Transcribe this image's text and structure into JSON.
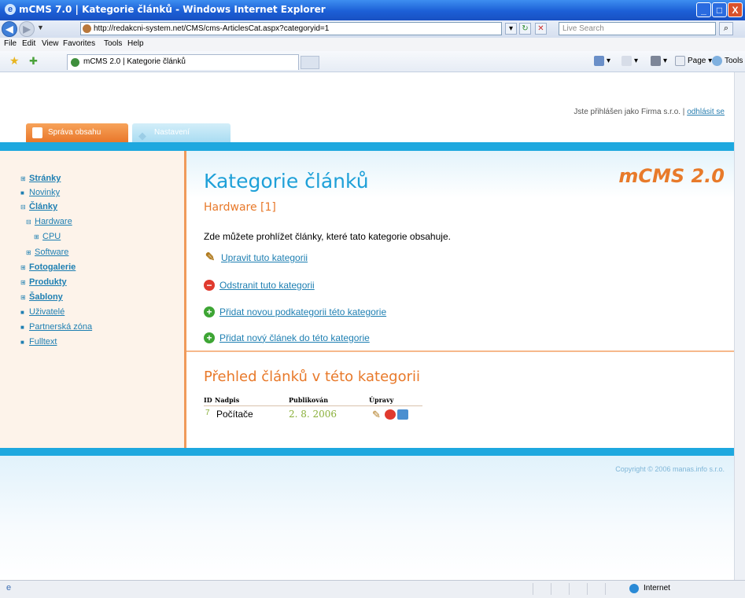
{
  "window": {
    "title": "mCMS 7.0 | Kategorie článků - Windows Internet Explorer",
    "min": "_",
    "max": "□",
    "close": "X"
  },
  "browser": {
    "url": "http://redakcni-system.net/CMS/cms-ArticlesCat.aspx?categoryid=1",
    "search_placeholder": "Live Search",
    "menu": [
      "File",
      "Edit",
      "View",
      "Favorites",
      "Tools",
      "Help"
    ],
    "tab_title": "mCMS 2.0 | Kategorie článků",
    "commands": {
      "page": "Page",
      "tools": "Tools"
    }
  },
  "header": {
    "logged_in": "Jste přihlášen jako Firma s.r.o. |",
    "logout": "odhlásit se",
    "tab_content": "Správa obsahu",
    "tab_settings": "Nastavení"
  },
  "sidebar": {
    "items": [
      {
        "label": "Stránky",
        "marker": "⊞",
        "bold": true
      },
      {
        "label": "Novinky",
        "marker": "■",
        "bold": false
      },
      {
        "label": "Články",
        "marker": "⊟",
        "bold": true
      },
      {
        "label": "Hardware",
        "marker": "⊟",
        "bold": false
      },
      {
        "label": "CPU",
        "marker": "⊞",
        "bold": false
      },
      {
        "label": "Software",
        "marker": "⊞",
        "bold": false
      },
      {
        "label": "Fotogalerie",
        "marker": "⊞",
        "bold": true
      },
      {
        "label": "Produkty",
        "marker": "⊞",
        "bold": true
      },
      {
        "label": "Šablony",
        "marker": "⊞",
        "bold": true
      },
      {
        "label": "Uživatelé",
        "marker": "■",
        "bold": false
      },
      {
        "label": "Partnerská zóna",
        "marker": "■",
        "bold": false
      },
      {
        "label": "Fulltext",
        "marker": "■",
        "bold": false
      }
    ]
  },
  "main": {
    "logo": "mCMS 2.0",
    "title": "Kategorie článků",
    "subtitle": "Hardware [1]",
    "intro": "Zde můžete prohlížet články, které tato kategorie obsahuje.",
    "actions": [
      "Upravit tuto kategorii",
      "Odstranit tuto kategorii",
      "Přidat novou podkategorii této kategorie",
      "Přidat nový článek do této kategorie"
    ],
    "section_title": "Přehled článků v této kategorii",
    "table": {
      "headers": [
        "ID",
        "Nadpis",
        "Publikován",
        "Úpravy"
      ],
      "rows": [
        {
          "id": "7",
          "title": "Počítače",
          "published": "2. 8. 2006"
        }
      ]
    }
  },
  "footer": {
    "copyright": "Copyright © 2006 manas.info s.r.o."
  },
  "status": {
    "zone": "Internet"
  },
  "colors": {
    "accent_blue": "#1ea8df",
    "accent_orange": "#e8792a",
    "link": "#1e7fb2"
  }
}
